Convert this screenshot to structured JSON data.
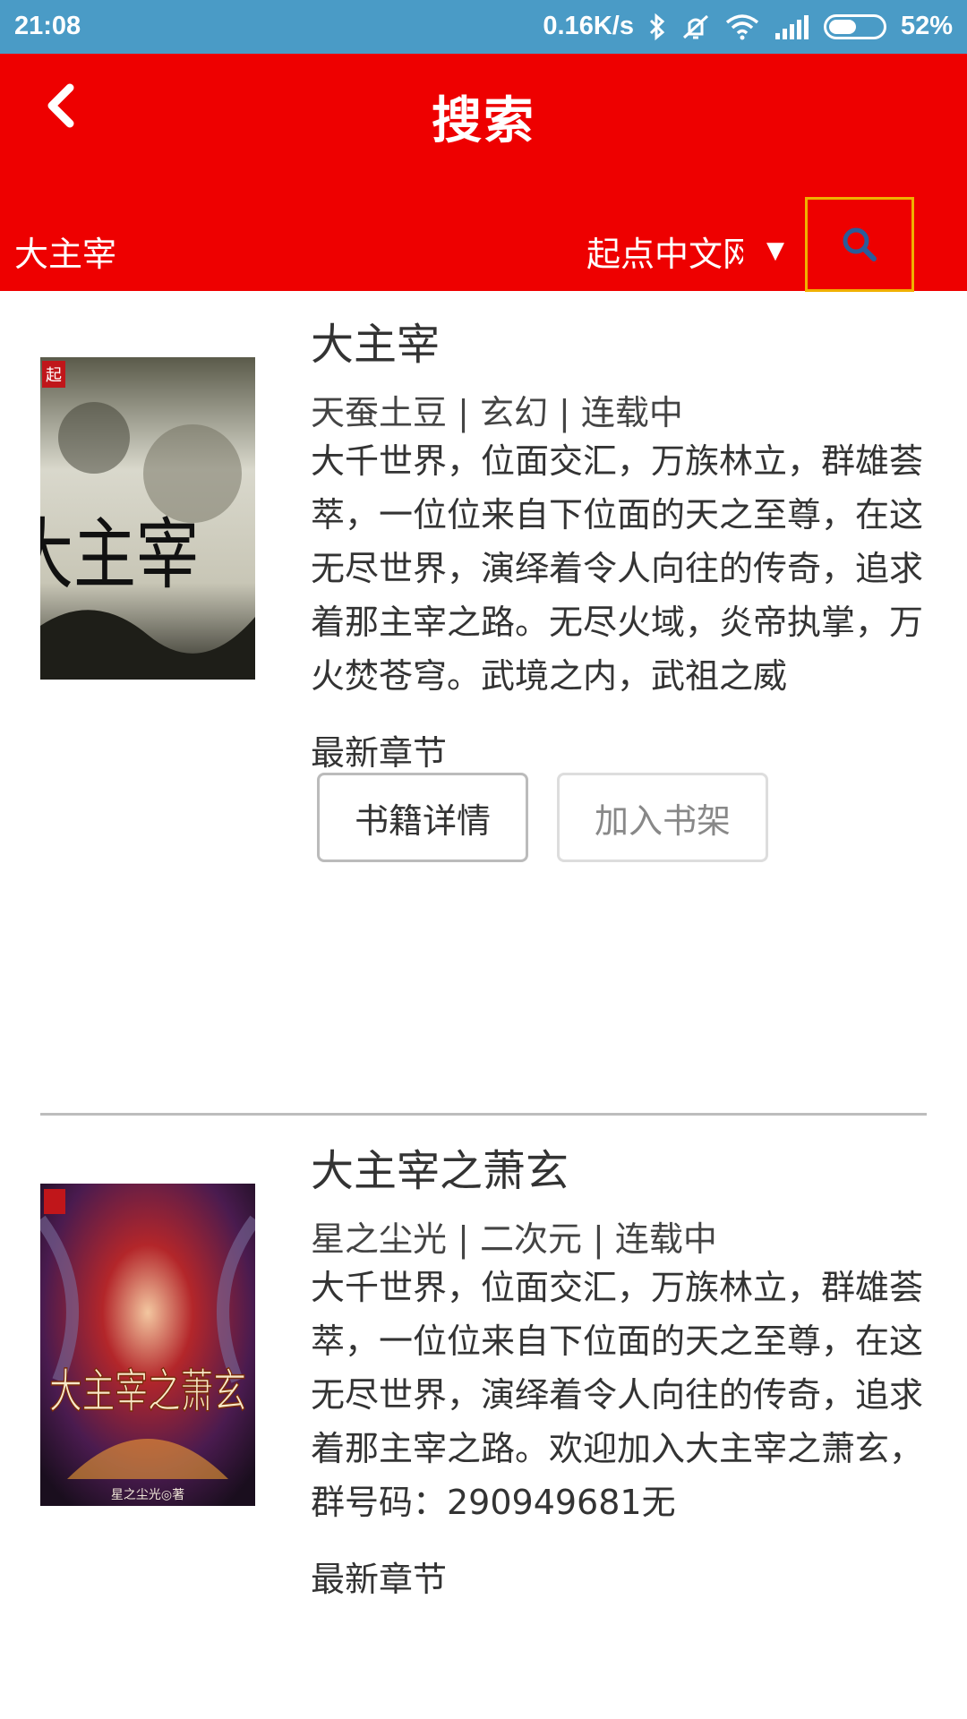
{
  "status_bar": {
    "time": "21:08",
    "net_speed": "0.16K/s",
    "battery": "52%",
    "battery_level": 0.52
  },
  "header": {
    "title": "搜索"
  },
  "search": {
    "query": "大主宰",
    "source": "起点中文网"
  },
  "results": [
    {
      "title": "大主宰",
      "meta": "天蚕土豆 | 玄幻 | 连载中",
      "description": "大千世界，位面交汇，万族林立，群雄荟萃，一位位来自下位面的天之至尊，在这无尽世界，演绎着令人向往的传奇，追求着那主宰之路。无尽火域，炎帝执掌，万火焚苍穹。武境之内，武祖之威",
      "latest_label": "最新章节",
      "detail_button": "书籍详情",
      "shelf_button": "加入书架",
      "cover_text": "大主宰"
    },
    {
      "title": "大主宰之萧玄",
      "meta": "星之尘光 | 二次元 | 连载中",
      "description": "大千世界，位面交汇，万族林立，群雄荟萃，一位位来自下位面的天之至尊，在这无尽世界，演绎着令人向往的传奇，追求着那主宰之路。欢迎加入大主宰之萧玄，群号码：290949681无",
      "latest_label": "最新章节",
      "cover_text": "大主宰之萧玄",
      "cover_author": "星之尘光◎著"
    }
  ],
  "colors": {
    "status_bar": "#4a9bc6",
    "toolbar": "#ee0000",
    "search_button_border": "#f0b000"
  },
  "icons": [
    "back-icon",
    "search-icon",
    "bluetooth-icon",
    "mute-icon",
    "wifi-icon",
    "signal-icon",
    "battery-icon",
    "dropdown-arrow-icon"
  ]
}
